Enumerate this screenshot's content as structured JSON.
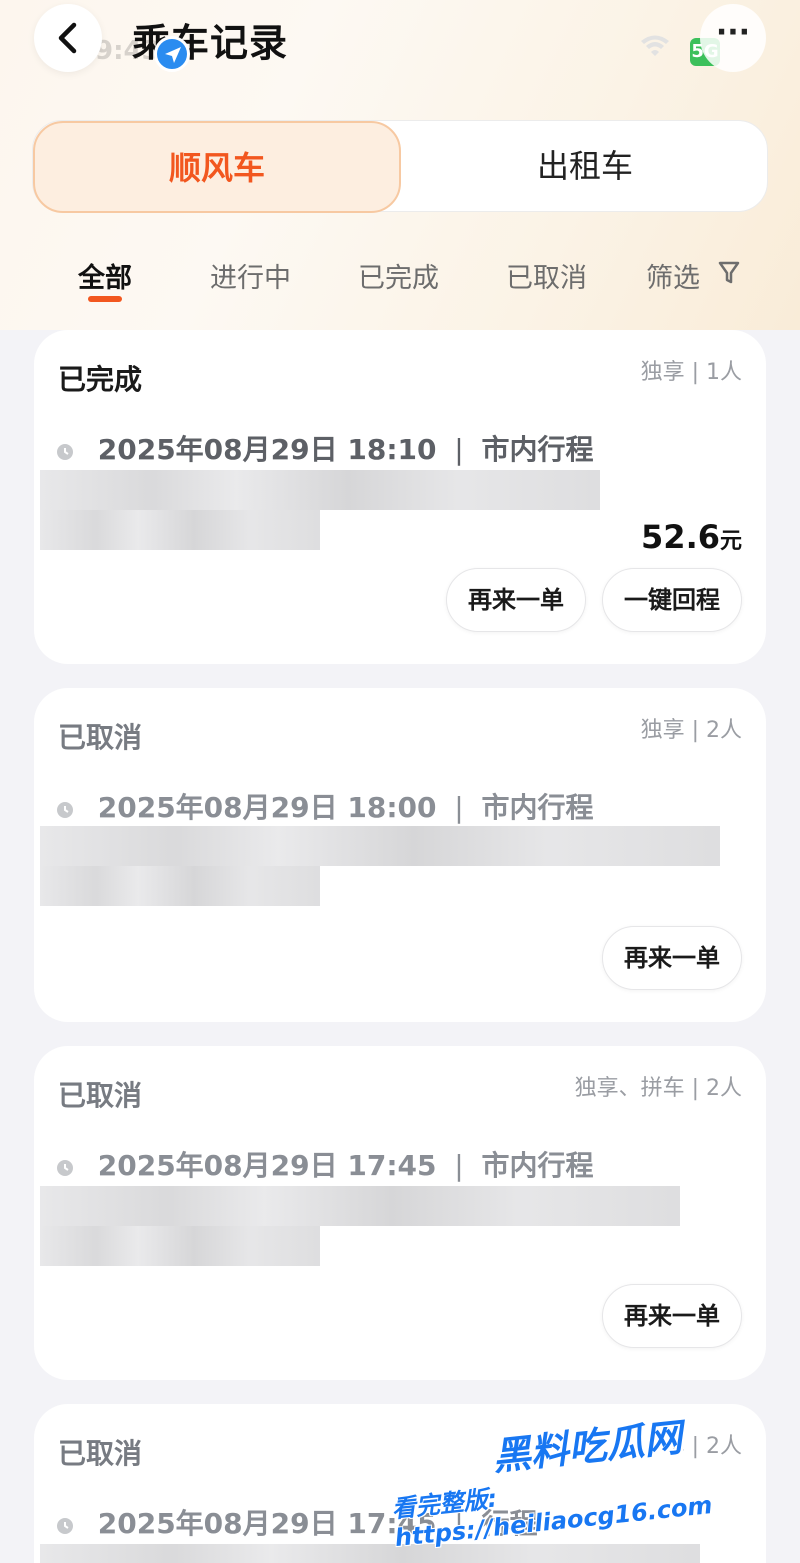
{
  "status_bar": {
    "time": "9:43",
    "network": "5G"
  },
  "header": {
    "title": "乘车记录",
    "more_label": "···"
  },
  "segment": {
    "tabs": [
      "顺风车",
      "出租车"
    ],
    "active_index": 0
  },
  "filter_tabs": {
    "items": [
      "全部",
      "进行中",
      "已完成",
      "已取消"
    ],
    "active_index": 0,
    "filter_label": "筛选"
  },
  "colors": {
    "accent": "#f2571f",
    "accent_bg": "#fdeee0",
    "location_badge": "#2a8cf0"
  },
  "orders": [
    {
      "status": "已完成",
      "meta": "独享 | 1人",
      "datetime": "2025年08月29日 18:10",
      "trip_type": "市内行程",
      "price": "52.6",
      "price_unit": "元",
      "buttons": [
        "再来一单",
        "一键回程"
      ]
    },
    {
      "status": "已取消",
      "meta": "独享 | 2人",
      "datetime": "2025年08月29日 18:00",
      "trip_type": "市内行程",
      "buttons": [
        "再来一单"
      ]
    },
    {
      "status": "已取消",
      "meta": "独享、拼车 | 2人",
      "datetime": "2025年08月29日 17:45",
      "trip_type": "市内行程",
      "buttons": [
        "再来一单"
      ]
    },
    {
      "status": "已取消",
      "meta": "享 | 2人",
      "datetime": "2025年08月29日 17:45",
      "trip_type": "行程"
    }
  ],
  "watermark": {
    "brand": "黑料吃瓜网",
    "url_text": "看完整版: https://heiliaocg16.com"
  }
}
